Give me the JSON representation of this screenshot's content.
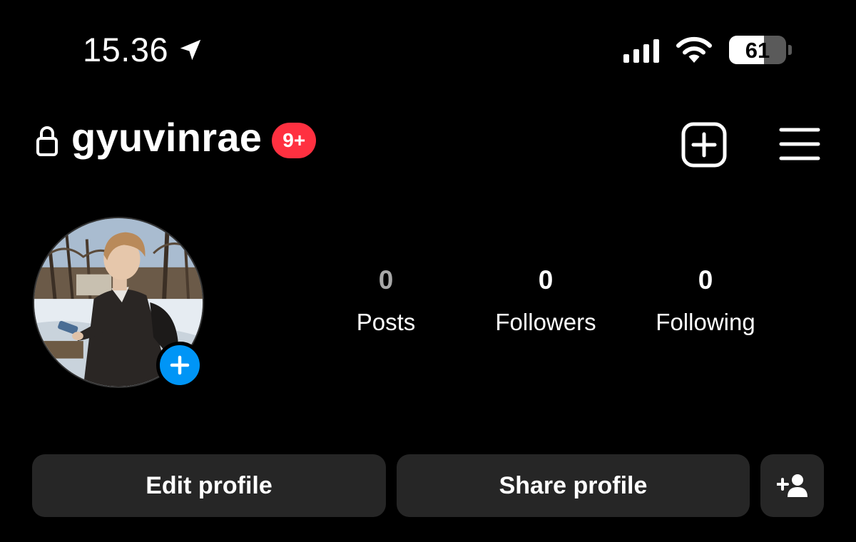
{
  "status_bar": {
    "time": "15.36",
    "battery_level": "61",
    "battery_fraction": 0.61,
    "icons": [
      "location-arrow-icon",
      "cellular-signal-icon",
      "wifi-icon",
      "battery-icon"
    ]
  },
  "header": {
    "username": "gyuvinrae",
    "notification_badge": "9+",
    "icons": [
      "lock-icon",
      "new-post-icon",
      "menu-icon"
    ]
  },
  "profile": {
    "avatar": "profile-photo",
    "add_story_icon": "plus-icon"
  },
  "stats": {
    "posts": {
      "value": "0",
      "label": "Posts"
    },
    "followers": {
      "value": "0",
      "label": "Followers"
    },
    "following": {
      "value": "0",
      "label": "Following"
    }
  },
  "actions": {
    "edit_profile": "Edit profile",
    "share_profile": "Share profile",
    "discover_people_icon": "add-person-icon"
  },
  "colors": {
    "background": "#000000",
    "button_background": "#262626",
    "badge_red": "#ff3040",
    "accent_blue": "#0095f6",
    "muted_text": "#a8a8a8"
  }
}
